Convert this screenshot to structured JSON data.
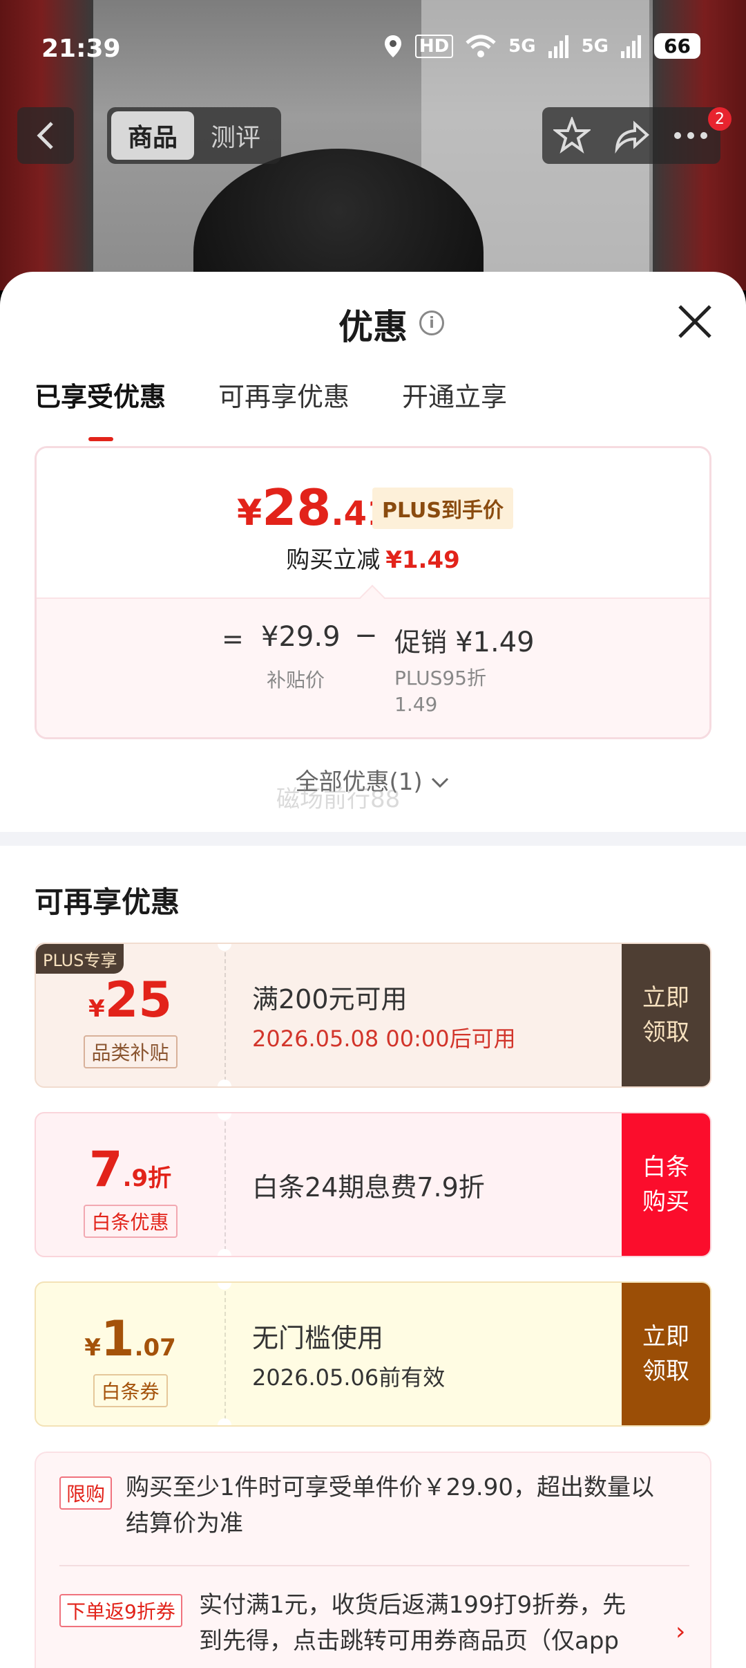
{
  "status_bar": {
    "time": "21:39",
    "hd": "HD",
    "net1": "5G",
    "net2": "5G",
    "battery": "66"
  },
  "nav": {
    "tabs": [
      "商品",
      "测评"
    ],
    "badge": "2"
  },
  "sheet": {
    "title": "优惠",
    "tabs": [
      "已享受优惠",
      "可再享优惠",
      "开通立享"
    ],
    "price": {
      "currency": "¥",
      "integer": "28",
      "decimal": ".41",
      "plus_tag": "PLUS到手价",
      "reduce_label": "购买立减",
      "reduce_amount": "¥1.49",
      "equals": "=",
      "base_price": "¥29.9",
      "minus": "−",
      "promo_label": "促销",
      "promo_amount": "¥1.49",
      "base_caption": "补贴价",
      "promo_caption_1": "PLUS95折",
      "promo_caption_2": "1.49"
    },
    "all_promo": "全部优惠(1)",
    "watermark": "磁场前行88",
    "section_title": "可再享优惠",
    "coupons": [
      {
        "corner": "PLUS专享",
        "currency": "¥",
        "big": "25",
        "small": "",
        "tag": "品类补贴",
        "line1": "满200元可用",
        "line2": "2026.05.08 00:00后可用",
        "button": "立即领取"
      },
      {
        "corner": "",
        "currency": "",
        "big": "7",
        "small": ".9折",
        "tag": "白条优惠",
        "line1": "白条24期息费7.9折",
        "line2": "",
        "button": "白条购买"
      },
      {
        "corner": "",
        "currency": "¥",
        "big": "1",
        "small": ".07",
        "tag": "白条券",
        "line1": "无门槛使用",
        "line2": "2026.05.06前有效",
        "button": "立即领取"
      }
    ],
    "limits": [
      {
        "tag": "限购",
        "text_1": "购买至少1件时可享受单件价￥29.90，超出数量以",
        "text_2": "结算价为准"
      },
      {
        "tag": "下单返9折券",
        "text_1": "实付满1元，收货后返满199打9折券，先",
        "text_2": "到先得，点击跳转可用券商品页（仅app"
      }
    ]
  },
  "colors": {
    "accent": "#e2231a",
    "plus_dark": "#4e3e33",
    "baitiao_red": "#fb0d2c",
    "coupon_brown": "#9b4e06"
  }
}
